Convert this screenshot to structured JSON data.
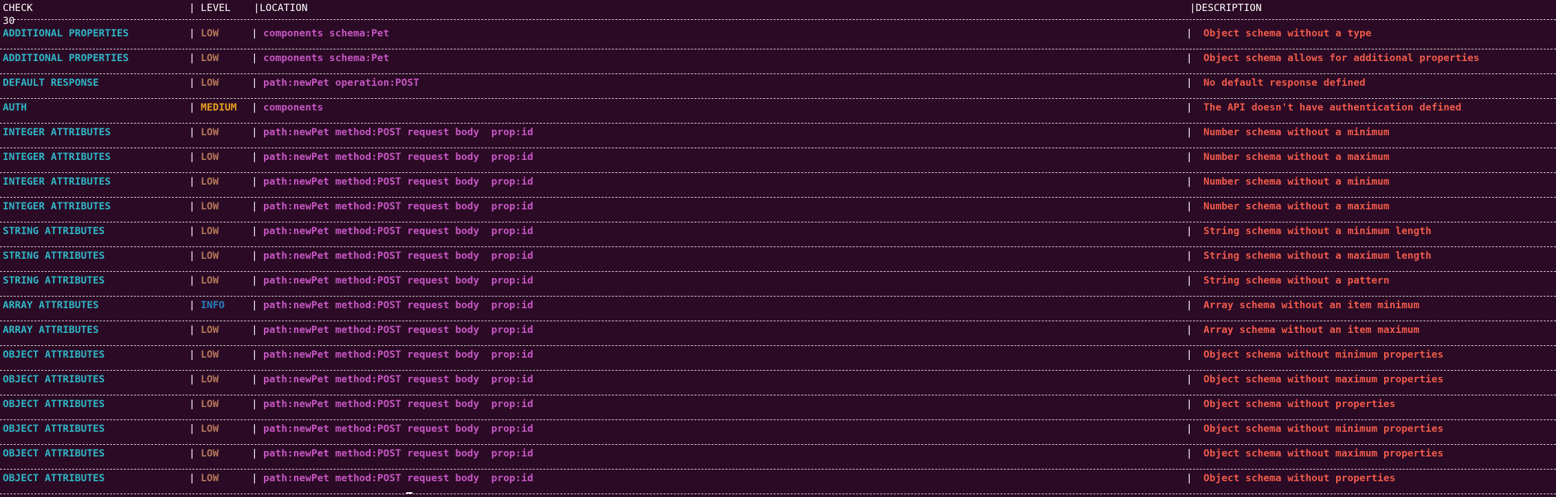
{
  "header": {
    "check": "CHECK",
    "pipe_level": "|",
    "level": "LEVEL",
    "location": "|LOCATION",
    "description": "|DESCRIPTION",
    "count": "30"
  },
  "colors": {
    "background": "#2b0a25",
    "check": "#2fb6c6",
    "location": "#c756c4",
    "description": "#ef5a4a",
    "level_low": "#b4785a",
    "level_medium": "#e8a020",
    "level_info": "#2a7fc0"
  },
  "rows": [
    {
      "check": "ADDITIONAL PROPERTIES",
      "level": "LOW",
      "location": "components schema:Pet",
      "description": "Object schema without a type"
    },
    {
      "check": "ADDITIONAL PROPERTIES",
      "level": "LOW",
      "location": "components schema:Pet",
      "description": "Object schema allows for additional properties"
    },
    {
      "check": "DEFAULT RESPONSE",
      "level": "LOW",
      "location": "path:newPet operation:POST",
      "description": "No default response defined"
    },
    {
      "check": "AUTH",
      "level": "MEDIUM",
      "location": "components",
      "description": "The API doesn't have authentication defined"
    },
    {
      "check": "INTEGER ATTRIBUTES",
      "level": "LOW",
      "location": "path:newPet method:POST request body  prop:id",
      "description": "Number schema without a minimum"
    },
    {
      "check": "INTEGER ATTRIBUTES",
      "level": "LOW",
      "location": "path:newPet method:POST request body  prop:id",
      "description": "Number schema without a maximum"
    },
    {
      "check": "INTEGER ATTRIBUTES",
      "level": "LOW",
      "location": "path:newPet method:POST request body  prop:id",
      "description": "Number schema without a minimum"
    },
    {
      "check": "INTEGER ATTRIBUTES",
      "level": "LOW",
      "location": "path:newPet method:POST request body  prop:id",
      "description": "Number schema without a maximum"
    },
    {
      "check": "STRING ATTRIBUTES",
      "level": "LOW",
      "location": "path:newPet method:POST request body  prop:id",
      "description": "String schema without a minimum length"
    },
    {
      "check": "STRING ATTRIBUTES",
      "level": "LOW",
      "location": "path:newPet method:POST request body  prop:id",
      "description": "String schema without a maximum length"
    },
    {
      "check": "STRING ATTRIBUTES",
      "level": "LOW",
      "location": "path:newPet method:POST request body  prop:id",
      "description": "String schema without a pattern"
    },
    {
      "check": "ARRAY ATTRIBUTES",
      "level": "INFO",
      "location": "path:newPet method:POST request body  prop:id",
      "description": "Array schema without an item minimum"
    },
    {
      "check": "ARRAY ATTRIBUTES",
      "level": "LOW",
      "location": "path:newPet method:POST request body  prop:id",
      "description": "Array schema without an item maximum"
    },
    {
      "check": "OBJECT ATTRIBUTES",
      "level": "LOW",
      "location": "path:newPet method:POST request body  prop:id",
      "description": "Object schema without minimum properties"
    },
    {
      "check": "OBJECT ATTRIBUTES",
      "level": "LOW",
      "location": "path:newPet method:POST request body  prop:id",
      "description": "Object schema without maximum properties"
    },
    {
      "check": "OBJECT ATTRIBUTES",
      "level": "LOW",
      "location": "path:newPet method:POST request body  prop:id",
      "description": "Object schema without properties"
    },
    {
      "check": "OBJECT ATTRIBUTES",
      "level": "LOW",
      "location": "path:newPet method:POST request body  prop:id",
      "description": "Object schema without minimum properties"
    },
    {
      "check": "OBJECT ATTRIBUTES",
      "level": "LOW",
      "location": "path:newPet method:POST request body  prop:id",
      "description": "Object schema without maximum properties"
    },
    {
      "check": "OBJECT ATTRIBUTES",
      "level": "LOW",
      "location": "path:newPet method:POST request body  prop:id",
      "description": "Object schema without properties"
    }
  ]
}
